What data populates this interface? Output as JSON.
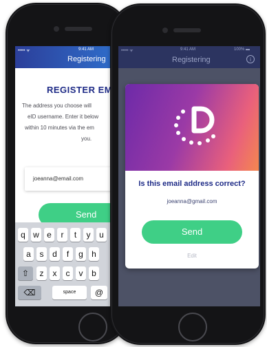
{
  "left_phone": {
    "status": {
      "carrier": "••••• ᯤ",
      "time": "9:41 AM"
    },
    "nav_title": "Registering",
    "heading": "REGISTER EM",
    "description": [
      "The address you choose will",
      "eID username. Enter it below",
      "within 10 minutes via the em",
      "you."
    ],
    "email_value": "joeanna@email.com",
    "send_label": "Send",
    "keyboard": {
      "row1": [
        "q",
        "w",
        "e",
        "r",
        "t",
        "y",
        "u"
      ],
      "row2": [
        "a",
        "s",
        "d",
        "f",
        "g",
        "h"
      ],
      "row3": [
        "z",
        "x",
        "c",
        "v",
        "b"
      ],
      "shift": "⇧",
      "backspace": "⌫",
      "space": "space",
      "at": "@"
    }
  },
  "right_phone": {
    "status": {
      "carrier": "••••• ᯤ",
      "time": "9:41 AM",
      "battery": "100% ▬"
    },
    "nav_title": "Registering",
    "info_icon": "i",
    "dialog": {
      "question": "Is this email address correct?",
      "email": "joeanna@gmail.com",
      "send_label": "Send",
      "edit_label": "Edit"
    }
  },
  "colors": {
    "brand_navy": "#1d2a86",
    "send_green": "#3fcf86",
    "gradient": [
      "#6d2aa8",
      "#e9607c",
      "#f4874f"
    ]
  }
}
